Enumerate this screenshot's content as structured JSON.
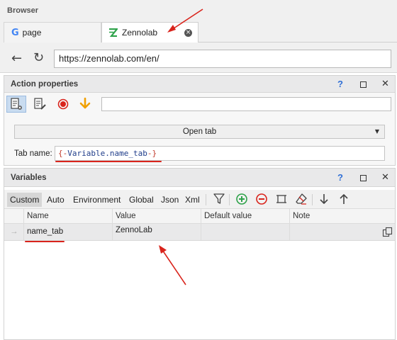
{
  "browser": {
    "title": "Browser",
    "tabs": [
      {
        "icon": "google-icon",
        "glyph": "G",
        "label": "page"
      },
      {
        "icon": "zennolab-icon",
        "label": "Zennolab",
        "close_glyph": "×"
      }
    ],
    "url": "https://zennolab.com/en/",
    "back_glyph": "←",
    "refresh_glyph": "↻"
  },
  "action_properties": {
    "title": "Action properties",
    "help": "?",
    "close": "✕",
    "toolbar_icons": [
      "action-settings-icon",
      "action-edit-icon",
      "record-icon",
      "download-arrow-icon"
    ],
    "filter_value": "",
    "action_select": "Open tab",
    "tab_name_label": "Tab name:",
    "tab_name_parts": {
      "open": "{-",
      "name": "Variable.name_tab",
      "close": "-}"
    }
  },
  "variables": {
    "title": "Variables",
    "help": "?",
    "close": "✕",
    "tabs": [
      "Custom",
      "Auto",
      "Environment",
      "Global",
      "Json",
      "Xml"
    ],
    "active_tab": "Custom",
    "toolbar_icons": [
      "filter-icon",
      "add-icon",
      "remove-icon",
      "clear-icon",
      "eraser-icon",
      "move-down-icon",
      "move-up-icon"
    ],
    "columns": [
      "Name",
      "Value",
      "Default value",
      "Note"
    ],
    "rows": [
      {
        "marker": "→",
        "name": "name_tab",
        "value": "ZennoLab",
        "default_value": "",
        "note": ""
      }
    ]
  },
  "colors": {
    "accent_red": "#d9241c",
    "help_blue": "#2f6fd6",
    "selected_row": "#e9e9ea"
  }
}
